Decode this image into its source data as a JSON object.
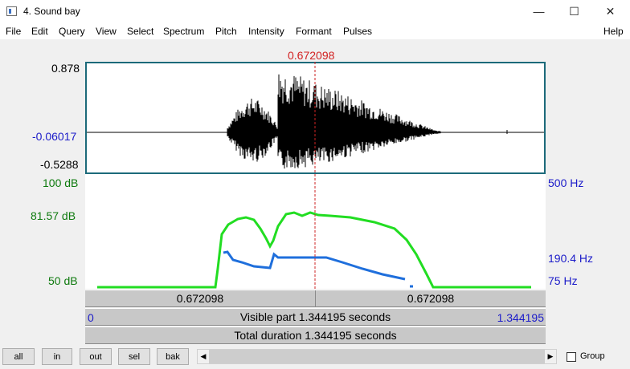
{
  "window": {
    "title": "4. Sound bay",
    "minimize_glyph": "—",
    "maximize_glyph": "☐",
    "close_glyph": "✕"
  },
  "menu": [
    "File",
    "Edit",
    "Query",
    "View",
    "Select",
    "Spectrum",
    "Pitch",
    "Intensity",
    "Formant",
    "Pulses",
    "Help"
  ],
  "cursor_time": "0.672098",
  "waveform": {
    "max_label": "0.878",
    "cursor_value_label": "-0.06017",
    "min_label": "-0.5288"
  },
  "intensity": {
    "top_label": "100 dB",
    "cursor_label": "81.57 dB",
    "bottom_label": "50 dB",
    "color": "#22dd22"
  },
  "pitch": {
    "top_label": "500 Hz",
    "cursor_label": "190.4 Hz",
    "bottom_label": "75 Hz",
    "color": "#1f6fdc"
  },
  "selection_bar": {
    "left_value": "0.672098",
    "right_value": "0.672098"
  },
  "visible_bar": {
    "start": "0",
    "text": "Visible part 1.344195 seconds",
    "end": "1.344195"
  },
  "total_bar": {
    "text": "Total duration 1.344195 seconds"
  },
  "toolbar": {
    "buttons": [
      "all",
      "in",
      "out",
      "sel",
      "bak"
    ],
    "scroll_left": "◀",
    "scroll_right": "▶",
    "group_label": "Group"
  },
  "colors": {
    "cursor_line": "#cc2222",
    "waveform": "#000000",
    "frame": "#1c6a7a"
  }
}
